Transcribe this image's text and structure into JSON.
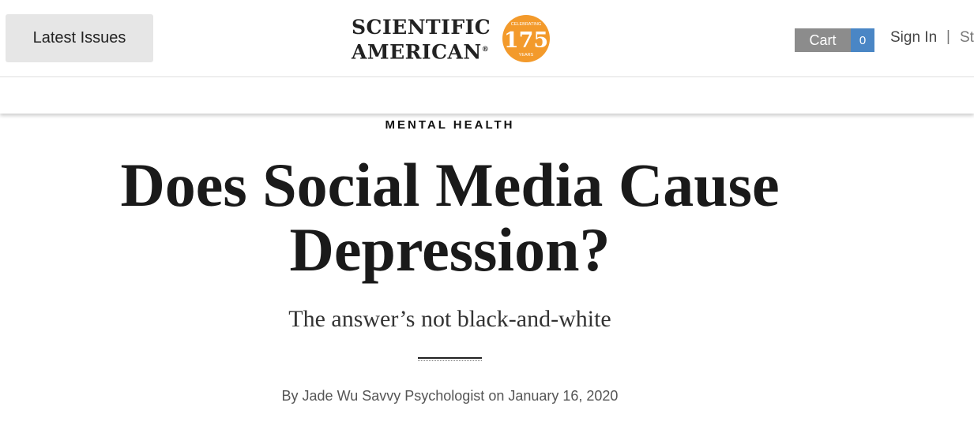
{
  "header": {
    "latest_issues": "Latest Issues",
    "logo_line1": "SCIENTIFIC",
    "logo_line2": "AMERICAN",
    "logo_registered": "®",
    "badge_top": "CELEBRATING",
    "badge_number": "175",
    "badge_bottom": "YEARS",
    "badge_color": "#f39a2b",
    "cart_label": "Cart",
    "cart_count": "0",
    "sign_in": "Sign In",
    "separator": "|",
    "subscribe_partial": "St"
  },
  "article": {
    "kicker": "MENTAL HEALTH",
    "headline": "Does Social Media Cause Depression?",
    "dek": "The answer’s not black-and-white",
    "byline": "By Jade Wu Savvy Psychologist on January 16, 2020"
  }
}
